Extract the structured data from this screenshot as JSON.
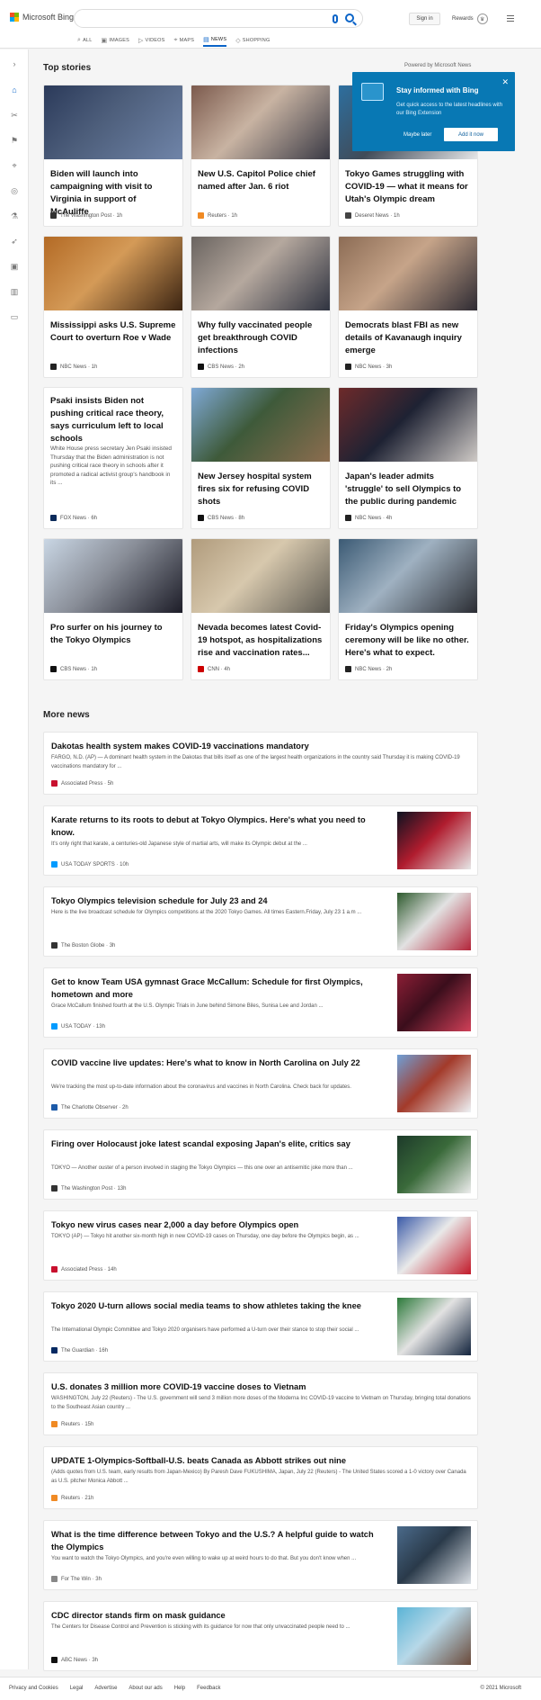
{
  "header": {
    "logo_text": "Microsoft Bing",
    "sign_in": "Sign in",
    "rewards": "Rewards",
    "tabs": [
      {
        "label": "ALL",
        "icon": "search-icon"
      },
      {
        "label": "IMAGES",
        "icon": "image-icon"
      },
      {
        "label": "VIDEOS",
        "icon": "video-icon"
      },
      {
        "label": "MAPS",
        "icon": "map-pin-icon"
      },
      {
        "label": "NEWS",
        "icon": "news-icon",
        "active": true
      },
      {
        "label": "SHOPPING",
        "icon": "tag-icon"
      }
    ]
  },
  "sidebar": [
    "expand-icon",
    "home-icon",
    "sports-icon",
    "flag-icon",
    "location-icon",
    "globe-icon",
    "science-icon",
    "rocket-icon",
    "entertainment-icon",
    "business-icon",
    "money-icon"
  ],
  "top_stories": {
    "title": "Top stories",
    "powered_by": "Powered by Microsoft News",
    "cards": [
      {
        "title": "Biden will launch into campaigning with visit to Virginia in support of McAuliffe",
        "source": "The Washington Post · 1h",
        "img_colors": [
          "#2b3a5a",
          "#6f84a8",
          "#4e5f7c"
        ]
      },
      {
        "title": "New U.S. Capitol Police chief named after Jan. 6 riot",
        "source": "Reuters · 1h",
        "img_colors": [
          "#7c5a4d",
          "#3a3a45",
          "#c8b3a2"
        ]
      },
      {
        "title": "Tokyo Games struggling with COVID-19 — what it means for Utah's Olympic dream",
        "source": "Deseret News · 1h",
        "img_colors": [
          "#2d6f9f",
          "#e5e6e8",
          "#404b58"
        ]
      },
      {
        "title": "Mississippi asks U.S. Supreme Court to overturn Roe v Wade",
        "source": "NBC News · 1h",
        "img_colors": [
          "#b36a25",
          "#3b2412",
          "#d49a57"
        ]
      },
      {
        "title": "Why fully vaccinated people get breakthrough COVID infections",
        "source": "CBS News · 2h",
        "img_colors": [
          "#6a6460",
          "#2f3340",
          "#b5a89e"
        ]
      },
      {
        "title": "Democrats blast FBI as new details of Kavanaugh inquiry emerge",
        "source": "NBC News · 3h",
        "img_colors": [
          "#8c6c55",
          "#2e2b33",
          "#c6a489"
        ]
      },
      {
        "title": "Psaki insists Biden not pushing critical race theory, says curriculum left to local schools",
        "desc": "White House press secretary Jen Psaki insisted Thursday that the Biden administration is not pushing critical race theory in schools after it promoted a radical activist group's handbook in its ...",
        "source": "FOX News · 6h"
      },
      {
        "title": "New Jersey hospital system fires six for refusing COVID shots",
        "source": "CBS News · 8h",
        "img_colors": [
          "#7fa9d6",
          "#8c6d4f",
          "#3e5a3a"
        ]
      },
      {
        "title": "Japan's leader admits 'struggle' to sell Olympics to the public during pandemic",
        "source": "NBC News · 4h",
        "img_colors": [
          "#6e2a2a",
          "#cfcac6",
          "#1e2233"
        ]
      },
      {
        "title": "Pro surfer on his journey to the Tokyo Olympics",
        "source": "CBS News · 1h",
        "img_colors": [
          "#c9d6e4",
          "#1d1d28",
          "#8a8f99"
        ]
      },
      {
        "title": "Nevada becomes latest Covid-19 hotspot, as hospitalizations rise and vaccination rates...",
        "source": "CNN · 4h",
        "img_colors": [
          "#b09b7c",
          "#5d5a52",
          "#d7c8ad"
        ]
      },
      {
        "title": "Friday's Olympics opening ceremony will be like no other. Here's what to expect.",
        "source": "NBC News · 2h",
        "img_colors": [
          "#3b5a74",
          "#2b2d33",
          "#9fb1c1"
        ]
      }
    ]
  },
  "popup": {
    "title": "Stay informed with Bing",
    "text": "Get quick access to the latest headlines with our Bing Extension",
    "maybe_later": "Maybe later",
    "add_now": "Add it now"
  },
  "more_news": {
    "title": "More news",
    "items": [
      {
        "title": "Dakotas health system makes COVID-19 vaccinations mandatory",
        "desc": "FARGO, N.D. (AP) — A dominant health system in the Dakotas that bills itself as one of the largest health organizations in the country said Thursday it is making COVID-19 vaccinations mandatory for ...",
        "source": "Associated Press · 5h"
      },
      {
        "title": "Karate returns to its roots to debut at Tokyo Olympics. Here's what you need to know.",
        "desc": "It's only right that karate, a centuries-old Japanese style of martial arts, will make its Olympic debut at the ...",
        "source": "USA TODAY SPORTS · 10h",
        "img_colors": [
          "#0c1220",
          "#e6e6e6",
          "#b01c2e"
        ]
      },
      {
        "title": "Tokyo Olympics television schedule for July 23 and 24",
        "desc": "Here is the live broadcast schedule for Olympics competitions at the 2020 Tokyo Games. All times Eastern.Friday, July 23 1 a.m ...",
        "source": "The Boston Globe · 3h",
        "img_colors": [
          "#2d5a2d",
          "#b3253a",
          "#e2e2e2"
        ]
      },
      {
        "title": "Get to know Team USA gymnast Grace McCallum: Schedule for first Olympics, hometown and more",
        "desc": "Grace McCallum finished fourth at the U.S. Olympic Trials in June behind Simone Biles, Sunisa Lee and Jordan ...",
        "source": "USA TODAY · 13h",
        "img_colors": [
          "#8b1e35",
          "#d04058",
          "#3b0e1c"
        ]
      },
      {
        "title": "COVID vaccine live updates: Here's what to know in North Carolina on July 22",
        "desc": "We're tracking the most up-to-date information about the coronavirus and vaccines in North Carolina. Check back for updates.",
        "source": "The Charlotte Observer · 2h",
        "img_colors": [
          "#6f9fd6",
          "#eef2f5",
          "#a33a2a"
        ]
      },
      {
        "title": "Firing over Holocaust joke latest scandal exposing Japan's elite, critics say",
        "desc": "TOKYO — Another ouster of a person involved in staging the Tokyo Olympics — this one over an antisemitic joke more than ...",
        "source": "The Washington Post · 13h",
        "img_colors": [
          "#1d3a2a",
          "#ededed",
          "#3a6a3a"
        ]
      },
      {
        "title": "Tokyo new virus cases near 2,000 a day before Olympics open",
        "desc": "TOKYO (AP) — Tokyo hit another six-month high in new COVID-19 cases on Thursday, one day before the Olympics begin, as ...",
        "source": "Associated Press · 14h",
        "img_colors": [
          "#3a5aa8",
          "#c21a2a",
          "#e9e9e9"
        ]
      },
      {
        "title": "Tokyo 2020 U-turn allows social media teams to show athletes taking the knee",
        "desc": "The International Olympic Committee and Tokyo 2020 organisers have performed a U-turn over their stance to stop their social ...",
        "source": "The Guardian · 16h",
        "img_colors": [
          "#2c7a3a",
          "#13243d",
          "#e2e2e2"
        ]
      },
      {
        "title": "U.S. donates 3 million more COVID-19 vaccine doses to Vietnam",
        "desc": "WASHINGTON, July 22 (Reuters) - The U.S. government will send 3 million more doses of the Moderna Inc COVID-19 vaccine to Vietnam on Thursday, bringing total donations to the Southeast Asian country ...",
        "source": "Reuters · 15h"
      },
      {
        "title": "UPDATE 1-Olympics-Softball-U.S. beats Canada as Abbott strikes out nine",
        "desc": "(Adds quotes from U.S. team, early results from Japan-Mexico) By Paresh Dave FUKUSHIMA, Japan, July 22 (Reuters) - The United States scored a 1-0 victory over Canada as U.S. pitcher Monica Abbott ...",
        "source": "Reuters · 21h"
      },
      {
        "title": "What is the time difference between Tokyo and the U.S.? A helpful guide to watch the Olympics",
        "desc": "You want to watch the Tokyo Olympics, and you're even willing to wake up at weird hours to do that. But you don't know when ...",
        "source": "For The Win · 3h",
        "img_colors": [
          "#4a6a8a",
          "#d8dde3",
          "#2a3a4a"
        ]
      },
      {
        "title": "CDC director stands firm on mask guidance",
        "desc": "The Centers for Disease Control and Prevention is sticking with its guidance for now that only unvaccinated people need to ...",
        "source": "ABC News · 3h",
        "img_colors": [
          "#5bb4d6",
          "#6a4a3a",
          "#b7d8e8"
        ]
      }
    ]
  },
  "footer": {
    "links": [
      "Privacy and Cookies",
      "Legal",
      "Advertise",
      "About our ads",
      "Help",
      "Feedback"
    ],
    "copyright": "© 2021 Microsoft"
  },
  "colors": {
    "accent": "#0a64c8",
    "popup_bg": "#0878b4"
  }
}
